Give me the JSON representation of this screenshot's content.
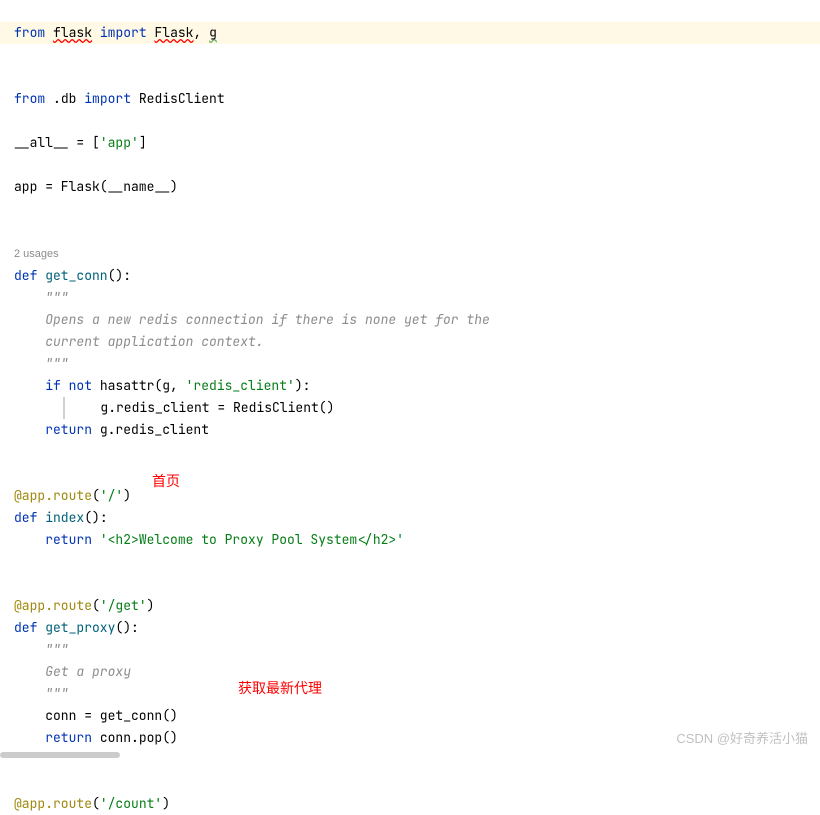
{
  "code": {
    "l1_from": "from",
    "l1_flask": "flask",
    "l1_import": "import",
    "l1_Flask": "Flask",
    "l1_comma": ", ",
    "l1_g": "g",
    "l3_from": "from",
    "l3_db": ".db",
    "l3_import": "import",
    "l3_RedisClient": "RedisClient",
    "l5_all": "__all__ = [",
    "l5_app_str": "'app'",
    "l5_close": "]",
    "l7_app": "app = Flask(__name__)",
    "usages": "2 usages",
    "l10_def": "def ",
    "l10_name": "get_conn",
    "l10_paren": "():",
    "l11_tq": "    \"\"\"",
    "l12_doc": "    Opens a new redis connection if there is none yet for the ",
    "l13_doc": "    current application context.",
    "l14_tq": "    \"\"\"",
    "l15_if": "if not ",
    "l15_hasattr": "hasattr(g, ",
    "l15_str": "'redis_client'",
    "l15_close": "):",
    "l16_assign": "g.redis_client = RedisClient()",
    "l17_return": "return ",
    "l17_val": "g.redis_client",
    "l20_dec": "@app.route",
    "l20_arg": "(",
    "l20_str": "'/'",
    "l20_close": ")",
    "l21_def": "def ",
    "l21_name": "index",
    "l21_paren": "():",
    "l22_return": "return ",
    "l22_str": "'<h2>Welcome to Proxy Pool System</h2>'",
    "l25_dec": "@app.route",
    "l25_arg": "(",
    "l25_str": "'/get'",
    "l25_close": ")",
    "l26_def": "def ",
    "l26_name": "get_proxy",
    "l26_paren": "():",
    "l27_tq": "    \"\"\"",
    "l28_doc": "    Get a proxy",
    "l29_tq": "    \"\"\"",
    "l30_conn": "    conn = get_conn()",
    "l31_return": "return ",
    "l31_val": "conn.pop()",
    "l34_dec": "@app.route",
    "l34_arg": "(",
    "l34_str": "'/count'",
    "l34_close": ")"
  },
  "annotations": {
    "homepage": "首页",
    "get_latest_proxy": "获取最新代理"
  },
  "watermark": "CSDN @好奇养活小猫"
}
